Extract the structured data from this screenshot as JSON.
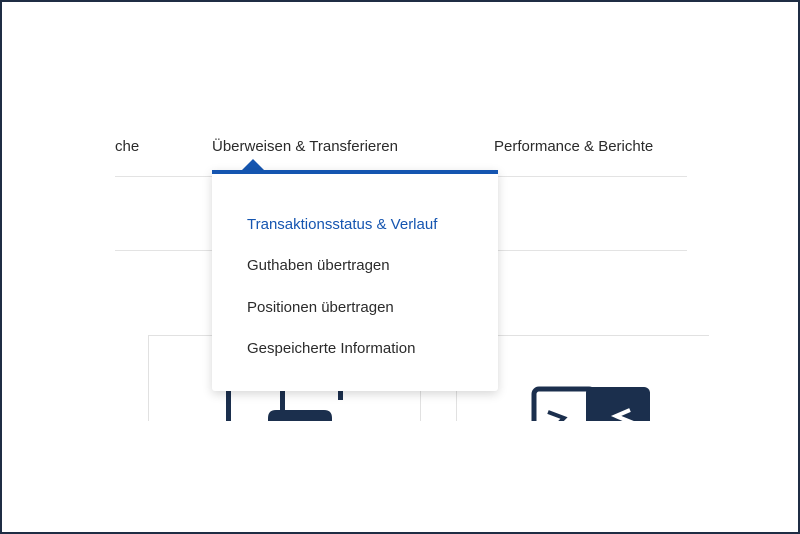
{
  "nav": {
    "items": [
      {
        "label": "che"
      },
      {
        "label": "Überweisen & Transferieren"
      },
      {
        "label": "Performance & Berichte"
      }
    ]
  },
  "dropdown": {
    "items": [
      {
        "label": "Transaktionsstatus & Verlauf",
        "active": true
      },
      {
        "label": "Guthaben übertragen",
        "active": false
      },
      {
        "label": "Positionen übertragen",
        "active": false
      },
      {
        "label": "Gespeicherte Information",
        "active": false
      }
    ]
  },
  "colors": {
    "accent": "#1555b0",
    "illustration_navy": "#1b2f4d",
    "frame": "#1f2d44",
    "divider": "#e3e3e3"
  },
  "icons": {
    "left_card": "document-upload-icon",
    "right_card": "transfer-arrows-icon"
  }
}
